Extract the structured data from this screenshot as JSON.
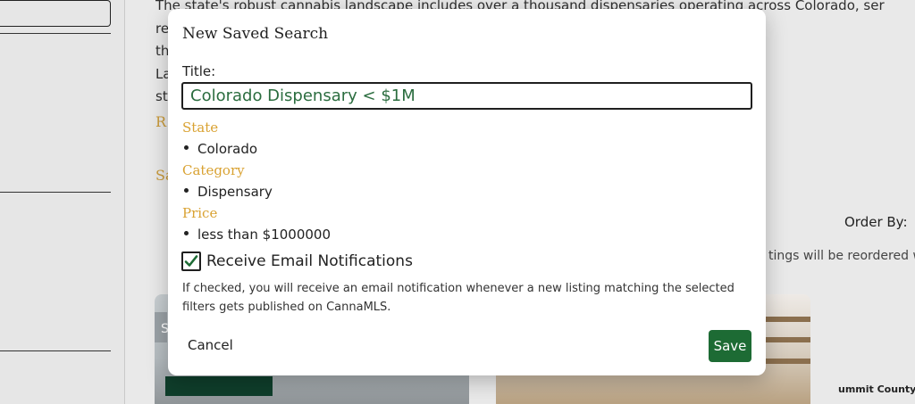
{
  "background": {
    "paragraph_lines": [
      "The state's robust cannabis landscape includes over a thousand dispensaries operating across Colorado, ser",
      "re                                                                                              e in bustling Denver, a",
      "th                                                                                             in cities like Colorado",
      "La                                                                                             cannabis markets in",
      "st"
    ],
    "gold_letter_1": "R",
    "gold_letter_2": "Sa",
    "order_by": "Order By:",
    "reorder_note": "tings will be reordered w",
    "card_overlay_letter": "S",
    "summit_label": "ummit County C"
  },
  "modal": {
    "title": "New Saved Search",
    "title_field_label": "Title:",
    "title_field_value": "Colorado Dispensary < $1M",
    "filters": [
      {
        "heading": "State",
        "values": [
          "Colorado"
        ]
      },
      {
        "heading": "Category",
        "values": [
          "Dispensary"
        ]
      },
      {
        "heading": "Price",
        "values": [
          "less than $1000000"
        ]
      }
    ],
    "email_notifications": {
      "label": "Receive Email Notifications",
      "checked": true,
      "help": "If checked, you will receive an email notification whenever a new listing matching the selected filters gets published on CannaMLS."
    },
    "cancel_label": "Cancel",
    "save_label": "Save"
  },
  "colors": {
    "accent_green": "#1d6b34",
    "input_text_green": "#2b6d3f",
    "section_gold": "#d9a232"
  },
  "icons": {
    "checkmark": "check-icon"
  }
}
